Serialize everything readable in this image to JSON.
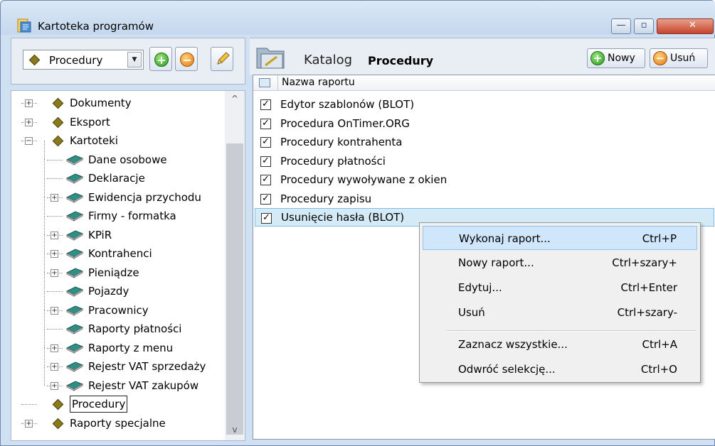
{
  "window": {
    "title": "Kartoteka programów",
    "min_glyph": "—",
    "max_glyph": "▫",
    "close_glyph": "✕"
  },
  "left_toolbar": {
    "combo_value": "Procedury",
    "combo_arrow": "▼",
    "add_glyph": "+",
    "remove_glyph": "−"
  },
  "tree": {
    "items": [
      {
        "label": "Dokumenty",
        "level": 0,
        "expander": "+",
        "icon": "diamond-icon"
      },
      {
        "label": "Eksport",
        "level": 0,
        "expander": "+",
        "icon": "diamond-icon"
      },
      {
        "label": "Kartoteki",
        "level": 0,
        "expander": "−",
        "icon": "diamond-icon"
      },
      {
        "label": "Dane osobowe",
        "level": 1,
        "expander": "",
        "icon": "book-icon"
      },
      {
        "label": "Deklaracje",
        "level": 1,
        "expander": "",
        "icon": "book-icon"
      },
      {
        "label": "Ewidencja przychodu",
        "level": 1,
        "expander": "+",
        "icon": "book-icon"
      },
      {
        "label": "Firmy - formatka",
        "level": 1,
        "expander": "",
        "icon": "book-icon"
      },
      {
        "label": "KPiR",
        "level": 1,
        "expander": "+",
        "icon": "book-icon"
      },
      {
        "label": "Kontrahenci",
        "level": 1,
        "expander": "+",
        "icon": "book-icon"
      },
      {
        "label": "Pieniądze",
        "level": 1,
        "expander": "+",
        "icon": "book-icon"
      },
      {
        "label": "Pojazdy",
        "level": 1,
        "expander": "",
        "icon": "book-icon"
      },
      {
        "label": "Pracownicy",
        "level": 1,
        "expander": "+",
        "icon": "book-icon"
      },
      {
        "label": "Raporty płatności",
        "level": 1,
        "expander": "",
        "icon": "book-icon"
      },
      {
        "label": "Raporty z menu",
        "level": 1,
        "expander": "+",
        "icon": "book-icon"
      },
      {
        "label": "Rejestr VAT sprzedaży",
        "level": 1,
        "expander": "+",
        "icon": "book-icon"
      },
      {
        "label": "Rejestr VAT zakupów",
        "level": 1,
        "expander": "+",
        "icon": "book-icon"
      },
      {
        "label": "Procedury",
        "level": 0,
        "expander": "",
        "icon": "diamond-icon",
        "selected": true
      },
      {
        "label": "Raporty specjalne",
        "level": 0,
        "expander": "+",
        "icon": "diamond-icon"
      }
    ],
    "scroll_up": "^",
    "scroll_down": "v"
  },
  "catalog": {
    "label": "Katalog",
    "value": "Procedury",
    "new_button": "Nowy",
    "delete_button": "Usuń",
    "new_glyph": "+",
    "delete_glyph": "−"
  },
  "list": {
    "column_header": "Nazwa raportu",
    "check_glyph": "✓",
    "rows": [
      {
        "label": "Edytor szablonów (BLOT)",
        "checked": true
      },
      {
        "label": "Procedura OnTimer.ORG",
        "checked": true
      },
      {
        "label": "Procedury kontrahenta",
        "checked": true
      },
      {
        "label": "Procedury płatności",
        "checked": true
      },
      {
        "label": "Procedury wywoływane z okien",
        "checked": true
      },
      {
        "label": "Procedury zapisu",
        "checked": true
      },
      {
        "label": "Usunięcie hasła (BLOT)",
        "checked": true,
        "selected": true
      }
    ]
  },
  "context_menu": {
    "items": [
      {
        "label": "Wykonaj raport...",
        "shortcut": "Ctrl+P",
        "highlighted": true
      },
      {
        "label": "Nowy raport...",
        "shortcut": "Ctrl+szary+"
      },
      {
        "label": "Edytuj...",
        "shortcut": "Ctrl+Enter"
      },
      {
        "label": "Usuń",
        "shortcut": "Ctrl+szary-"
      },
      {
        "label": "Zaznacz wszystkie...",
        "shortcut": "Ctrl+A"
      },
      {
        "label": "Odwróć selekcję...",
        "shortcut": "Ctrl+O"
      }
    ]
  }
}
